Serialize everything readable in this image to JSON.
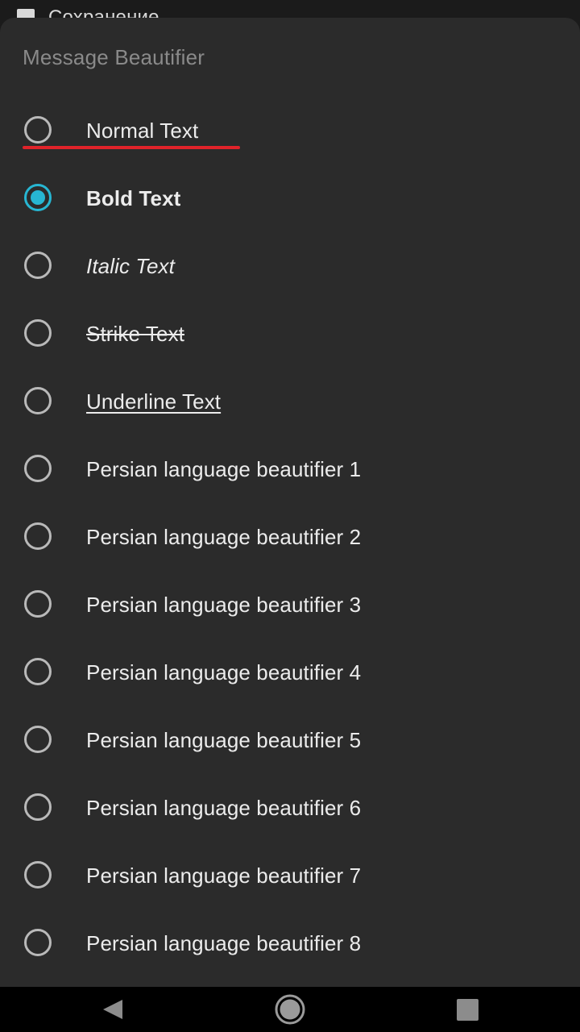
{
  "status_bar": {
    "icon": "image-icon",
    "text": "Сохранение..."
  },
  "dialog": {
    "title": "Message Beautifier",
    "accent_color": "#27b6d2",
    "selected_index": 1,
    "options": [
      {
        "label": "Normal Text",
        "checked": false
      },
      {
        "label": "Bold Text",
        "checked": true
      },
      {
        "label": "Italic Text",
        "checked": false
      },
      {
        "label": "Strike Text",
        "checked": false
      },
      {
        "label": "Underline Text",
        "checked": false
      },
      {
        "label": "Persian language beautifier 1",
        "checked": false
      },
      {
        "label": "Persian language beautifier 2",
        "checked": false
      },
      {
        "label": "Persian language beautifier 3",
        "checked": false
      },
      {
        "label": "Persian language beautifier 4",
        "checked": false
      },
      {
        "label": "Persian language beautifier 5",
        "checked": false
      },
      {
        "label": "Persian language beautifier 6",
        "checked": false
      },
      {
        "label": "Persian language beautifier 7",
        "checked": false
      },
      {
        "label": "Persian language beautifier 8",
        "checked": false
      }
    ]
  },
  "annotation": {
    "color": "#e0232a"
  },
  "nav_bar": {
    "buttons": [
      "back-icon",
      "home-icon",
      "recents-icon"
    ]
  }
}
